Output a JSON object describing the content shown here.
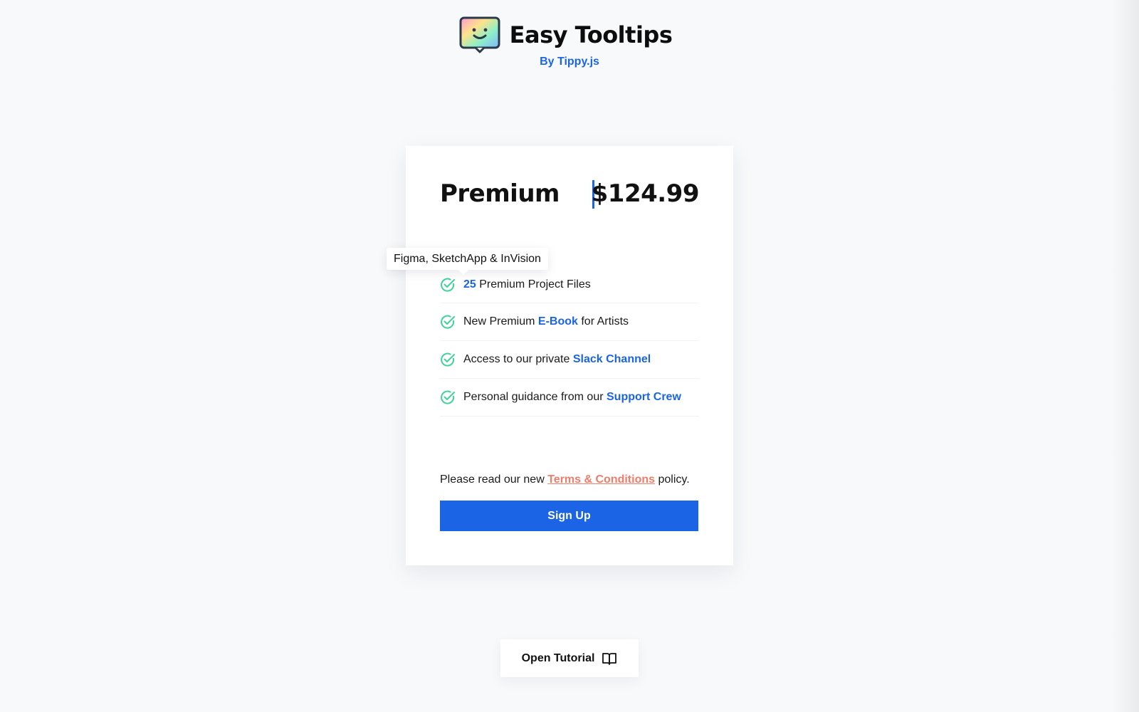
{
  "brand": {
    "title": "Easy Tooltips",
    "subtitle": "By Tippy.js",
    "logo_icon": "smiley-tooltip-logo-icon"
  },
  "plan": {
    "name": "Premium",
    "price": "$124.99",
    "accent_color": "#1b64e6"
  },
  "tooltip": {
    "text": "Figma, SketchApp & InVision"
  },
  "features": [
    {
      "icon": "check-circle-icon",
      "highlight": "25",
      "after": " Premium Project Files"
    },
    {
      "icon": "check-circle-icon",
      "before": "New Premium ",
      "highlight": "E-Book",
      "after": " for Artists"
    },
    {
      "icon": "check-circle-icon",
      "before": "Access to our private ",
      "highlight": "Slack Channel"
    },
    {
      "icon": "check-circle-icon",
      "before": "Personal guidance from our ",
      "highlight": "Support Crew"
    }
  ],
  "terms": {
    "before": "Please read our new ",
    "link": "Terms & Conditions",
    "after": " policy.",
    "link_color": "#f07d6a"
  },
  "signup": {
    "label": "Sign Up",
    "color": "#1b64e6"
  },
  "tutorial": {
    "label": "Open Tutorial",
    "icon": "open-book-icon"
  },
  "colors": {
    "background": "#f8f9fb",
    "check": "#3fd39a"
  }
}
